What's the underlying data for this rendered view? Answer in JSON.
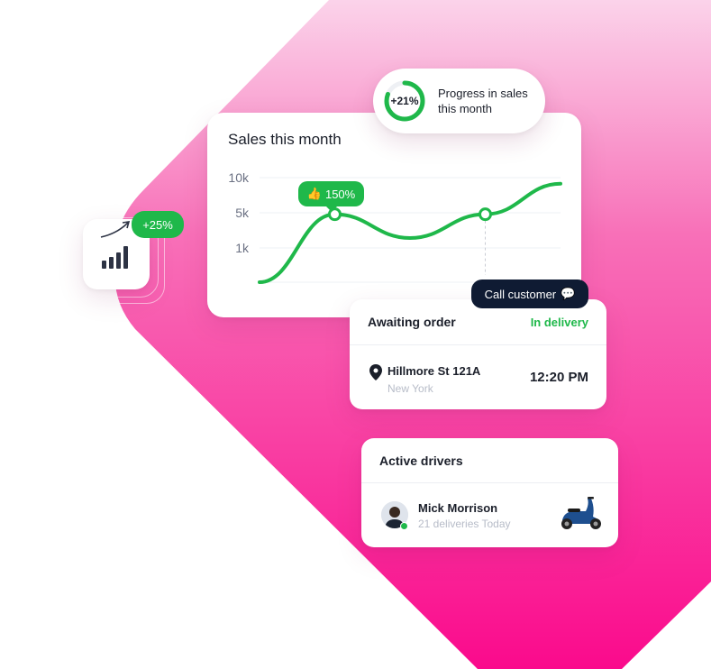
{
  "colors": {
    "accent": "#1fb84a",
    "pink_top": "#f7c6e0",
    "pink_bottom": "#fa0a8c",
    "dark": "#0f1b33"
  },
  "growth_widget": {
    "badge": "+25%",
    "icon": "bar-chart-icon"
  },
  "progress": {
    "value": "+21%",
    "percent": 21,
    "label": "Progress in sales this month"
  },
  "sales_chart": {
    "title": "Sales this month",
    "badge": "150%",
    "badge_icon": "thumbs-up-icon"
  },
  "chart_data": {
    "type": "line",
    "title": "Sales this month",
    "y_ticks": [
      "10k",
      "5k",
      "1k"
    ],
    "grid": true,
    "series": [
      {
        "points": [
          {
            "x": 0,
            "y": 0
          },
          {
            "x": 1,
            "y": 2
          },
          {
            "x": 2,
            "y": 1.3
          },
          {
            "x": 3,
            "y": 2
          },
          {
            "x": 4,
            "y": 2.9
          }
        ],
        "highlighted": [
          1,
          3
        ]
      }
    ]
  },
  "call_button": {
    "label": "Call customer",
    "icon": "chat-bubble-icon"
  },
  "order": {
    "title": "Awaiting order",
    "status": "In delivery",
    "street": "Hillmore St 121A",
    "city": "New York",
    "time": "12:20 PM"
  },
  "drivers": {
    "title": "Active drivers",
    "name": "Mick Morrison",
    "deliveries": "21 deliveries Today"
  }
}
